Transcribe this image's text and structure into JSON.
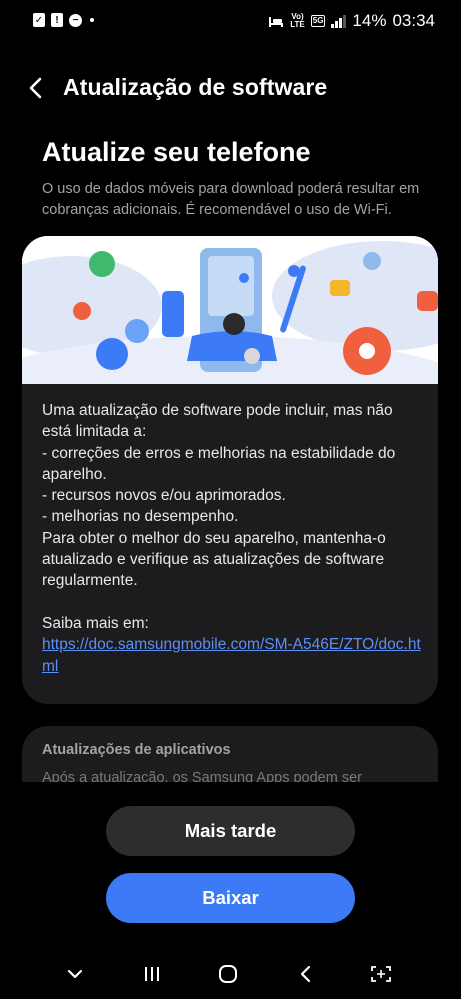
{
  "status_bar": {
    "battery": "14%",
    "time": "03:34",
    "network_top": "Vo)",
    "network_bottom": "LTE",
    "network_type": "5G",
    "notification_icons": [
      "clipboard-check-icon",
      "alert-icon",
      "do-not-disturb-icon",
      "dot-icon"
    ],
    "system_icons": [
      "sleep-bed-icon",
      "volte-icon",
      "5g-icon",
      "signal-icon"
    ]
  },
  "header": {
    "title": "Atualização de software",
    "back_icon": "chevron-left-icon"
  },
  "main": {
    "heading": "Atualize seu telefone",
    "subtext": "O uso de dados móveis para download poderá resultar em cobranças adicionais. É recomendável o uso de Wi-Fi."
  },
  "update_card": {
    "intro": "Uma atualização de software pode incluir, mas não está limitada a:",
    "items": [
      " - correções de erros e melhorias na estabilidade do aparelho.",
      " - recursos novos e/ou aprimorados.",
      " - melhorias no desempenho."
    ],
    "advice": "Para obter o melhor do seu aparelho, mantenha-o atualizado e verifique as atualizações de software regularmente.",
    "learn_more": "Saiba mais em:",
    "link": "https://doc.samsungmobile.com/SM-A546E/ZTO/doc.html"
  },
  "apps_card": {
    "title": "Atualizações de aplicativos",
    "text": "Após a atualização, os Samsung Apps podem ser"
  },
  "buttons": {
    "later": "Mais tarde",
    "download": "Baixar"
  },
  "nav_bar": {
    "icons": [
      "chevron-down-icon",
      "recent-apps-icon",
      "home-icon",
      "back-icon",
      "screenshot-icon"
    ]
  },
  "colors": {
    "background": "#000000",
    "card": "#1c1c1e",
    "accent": "#3d7bf6",
    "link": "#5d8ff5",
    "secondary_text": "#a3a3a3"
  }
}
